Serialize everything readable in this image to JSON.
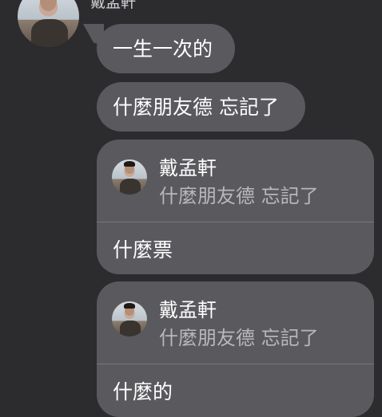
{
  "chat": {
    "sender_name": "戴孟軒",
    "messages": [
      {
        "text": "一生一次的"
      },
      {
        "text": "什麼朋友德 忘記了"
      }
    ],
    "replies": [
      {
        "quote_name": "戴孟軒",
        "quote_text": "什麼朋友德 忘記了",
        "reply_text": "什麼票"
      },
      {
        "quote_name": "戴孟軒",
        "quote_text": "什麼朋友德 忘記了",
        "reply_text": "什麼的"
      }
    ]
  },
  "colors": {
    "background": "#2c2c2f",
    "bubble": "#59595e",
    "quote_text": "#b7b7bc",
    "divider": "#77777c"
  }
}
